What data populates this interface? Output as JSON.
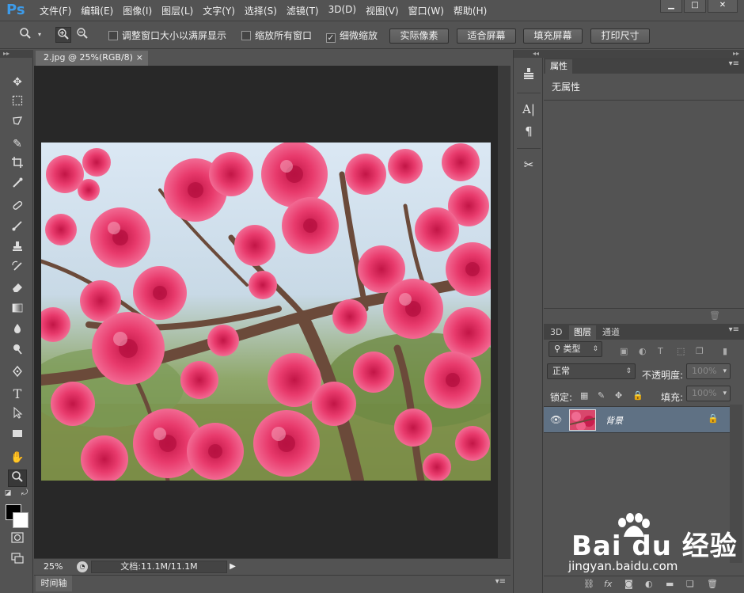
{
  "app": {
    "logo": "Ps"
  },
  "menus": [
    "文件(F)",
    "编辑(E)",
    "图像(I)",
    "图层(L)",
    "文字(Y)",
    "选择(S)",
    "滤镜(T)",
    "3D(D)",
    "视图(V)",
    "窗口(W)",
    "帮助(H)"
  ],
  "window_controls": {
    "minimize": "▁",
    "maximize": "□",
    "close": "✕"
  },
  "options": {
    "resize_window_label": "调整窗口大小以满屏显示",
    "resize_window_checked": false,
    "zoom_all_label": "缩放所有窗口",
    "zoom_all_checked": false,
    "scrubby_zoom_label": "细微缩放",
    "scrubby_zoom_checked": true,
    "scrubby_check_glyph": "✓",
    "btn_actual_pixels": "实际像素",
    "btn_fit_screen": "适合屏幕",
    "btn_fill_screen": "填充屏幕",
    "btn_print_size": "打印尺寸"
  },
  "document": {
    "tab_title": "2.jpg @ 25%(RGB/8)",
    "tab_close": "×",
    "zoom": "25%",
    "doc_info": "文档:11.1M/11.1M",
    "status_arrow": "▶"
  },
  "timeline": {
    "label": "时间轴"
  },
  "properties": {
    "tab": "属性",
    "content": "无属性"
  },
  "layers_panel": {
    "tabs": [
      "3D",
      "图层",
      "通道"
    ],
    "active_tab": 1,
    "filter_kind": "类型",
    "blend_mode": "正常",
    "opacity_label": "不透明度:",
    "opacity_value": "100%",
    "lock_label": "锁定:",
    "fill_label": "填充:",
    "fill_value": "100%",
    "layers": [
      {
        "name": "背景",
        "visible": true,
        "locked": true
      }
    ]
  },
  "watermark": {
    "brand": "Bai  du 经验",
    "url": "jingyan.baidu.com"
  },
  "colors": {
    "background": "#535353",
    "canvas_bg": "#282828",
    "layer_selected": "#5f7184",
    "ps_blue": "#3d9be9",
    "foreground_swatch": "#000000",
    "background_swatch": "#ffffff"
  }
}
